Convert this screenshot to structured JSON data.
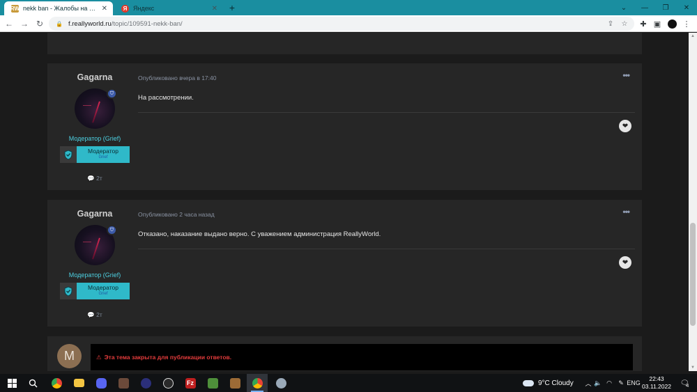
{
  "browser": {
    "tabs": [
      {
        "title": "nekk ban - Жалобы на АнтиЧит",
        "favicon": "RW"
      },
      {
        "title": "Яндекс",
        "favicon": "Я"
      }
    ],
    "new_tab": "+",
    "window_controls": {
      "dropdown": "⌄",
      "minimize": "—",
      "maximize": "❐",
      "close": "✕"
    },
    "address": {
      "host": "f.reallyworld.ru",
      "path": "/topic/109591-nekk-ban/"
    },
    "nav": {
      "back": "←",
      "forward": "→",
      "reload": "↻"
    }
  },
  "posts": [
    {
      "author": "Gagarna",
      "published": "Опубликовано вчера в 17:40",
      "role": "Модератор (Grief)",
      "rank_title": "Модератор",
      "rank_sub": "Grief",
      "comments": "2т",
      "content": "На рассмотрении."
    },
    {
      "author": "Gagarna",
      "published": "Опубликовано 2 часа назад",
      "role": "Модератор (Grief)",
      "rank_title": "Модератор",
      "rank_sub": "Grief",
      "comments": "2т",
      "content": "Отказано, наказание выдано верно. С уважением администрация ReallyWorld."
    }
  ],
  "reply": {
    "avatar_letter": "M",
    "locked_message": "Эта тема закрыта для публикации ответов."
  },
  "taskbar": {
    "weather": "9°C  Cloudy",
    "language": "ENG",
    "time": "22:43",
    "date": "03.11.2022",
    "notifications": "4"
  },
  "colors": {
    "tab_strip": "#1a8ea0",
    "accent_cyan": "#4dd0e1",
    "rank_badge": "#2fb9c9",
    "locked_text": "#e23b3b"
  }
}
